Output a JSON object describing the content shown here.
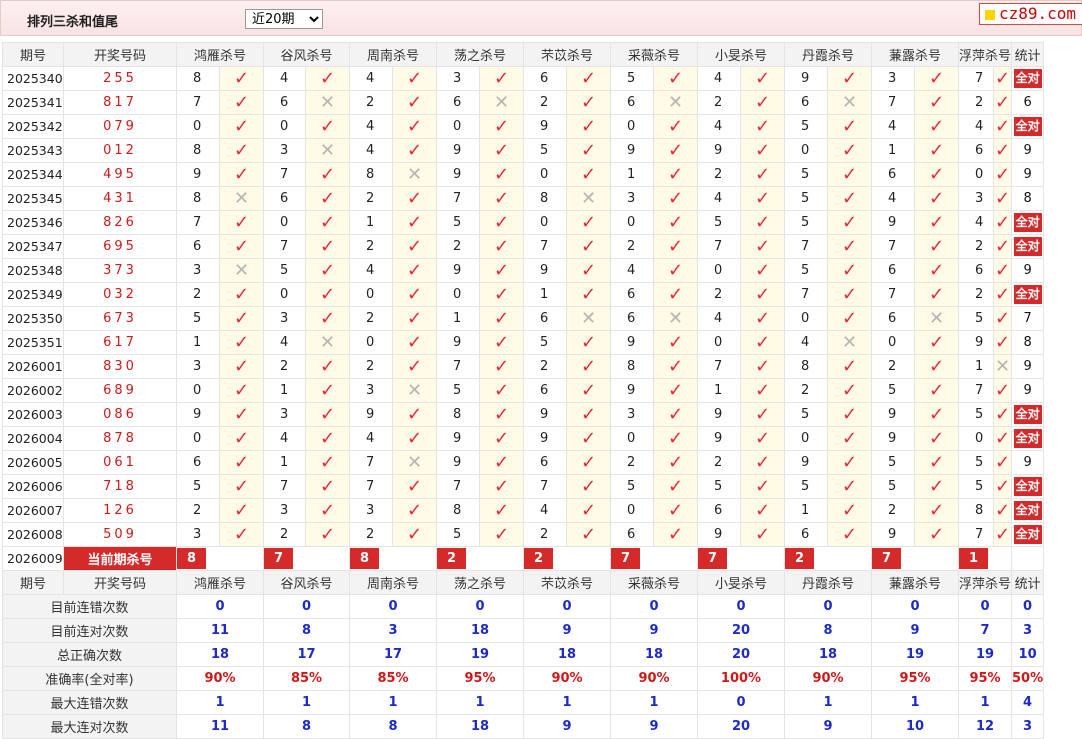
{
  "toolbar": {
    "title": "排列三杀和值尾",
    "period_options": [
      "近20期"
    ],
    "period_selected": "近20期",
    "logo_text": "cz89.com"
  },
  "columns": {
    "issue_label": "期号",
    "number_label": "开奖号码",
    "killers": [
      "鸿雁杀号",
      "谷风杀号",
      "周南杀号",
      "荡之杀号",
      "芣苡杀号",
      "采薇杀号",
      "小旻杀号",
      "丹霞杀号",
      "蒹露杀号",
      "浮萍杀号"
    ],
    "stat_label": "统计"
  },
  "rows": [
    {
      "issue": "2025340",
      "number": "255",
      "kills": [
        {
          "v": "8",
          "ok": true
        },
        {
          "v": "4",
          "ok": true
        },
        {
          "v": "4",
          "ok": true
        },
        {
          "v": "3",
          "ok": true
        },
        {
          "v": "6",
          "ok": true
        },
        {
          "v": "5",
          "ok": true
        },
        {
          "v": "4",
          "ok": true
        },
        {
          "v": "9",
          "ok": true
        },
        {
          "v": "3",
          "ok": true
        },
        {
          "v": "7",
          "ok": true
        }
      ],
      "stat": "全对"
    },
    {
      "issue": "2025341",
      "number": "817",
      "kills": [
        {
          "v": "7",
          "ok": true
        },
        {
          "v": "6",
          "ok": false
        },
        {
          "v": "2",
          "ok": true
        },
        {
          "v": "6",
          "ok": false
        },
        {
          "v": "2",
          "ok": true
        },
        {
          "v": "6",
          "ok": false
        },
        {
          "v": "2",
          "ok": true
        },
        {
          "v": "6",
          "ok": false
        },
        {
          "v": "7",
          "ok": true
        },
        {
          "v": "2",
          "ok": true
        }
      ],
      "stat": "6"
    },
    {
      "issue": "2025342",
      "number": "079",
      "kills": [
        {
          "v": "0",
          "ok": true
        },
        {
          "v": "0",
          "ok": true
        },
        {
          "v": "4",
          "ok": true
        },
        {
          "v": "0",
          "ok": true
        },
        {
          "v": "9",
          "ok": true
        },
        {
          "v": "0",
          "ok": true
        },
        {
          "v": "4",
          "ok": true
        },
        {
          "v": "5",
          "ok": true
        },
        {
          "v": "4",
          "ok": true
        },
        {
          "v": "4",
          "ok": true
        }
      ],
      "stat": "全对"
    },
    {
      "issue": "2025343",
      "number": "012",
      "kills": [
        {
          "v": "8",
          "ok": true
        },
        {
          "v": "3",
          "ok": false
        },
        {
          "v": "4",
          "ok": true
        },
        {
          "v": "9",
          "ok": true
        },
        {
          "v": "5",
          "ok": true
        },
        {
          "v": "9",
          "ok": true
        },
        {
          "v": "9",
          "ok": true
        },
        {
          "v": "0",
          "ok": true
        },
        {
          "v": "1",
          "ok": true
        },
        {
          "v": "6",
          "ok": true
        }
      ],
      "stat": "9"
    },
    {
      "issue": "2025344",
      "number": "495",
      "kills": [
        {
          "v": "9",
          "ok": true
        },
        {
          "v": "7",
          "ok": true
        },
        {
          "v": "8",
          "ok": false
        },
        {
          "v": "9",
          "ok": true
        },
        {
          "v": "0",
          "ok": true
        },
        {
          "v": "1",
          "ok": true
        },
        {
          "v": "2",
          "ok": true
        },
        {
          "v": "5",
          "ok": true
        },
        {
          "v": "6",
          "ok": true
        },
        {
          "v": "0",
          "ok": true
        }
      ],
      "stat": "9"
    },
    {
      "issue": "2025345",
      "number": "431",
      "kills": [
        {
          "v": "8",
          "ok": false
        },
        {
          "v": "6",
          "ok": true
        },
        {
          "v": "2",
          "ok": true
        },
        {
          "v": "7",
          "ok": true
        },
        {
          "v": "8",
          "ok": false
        },
        {
          "v": "3",
          "ok": true
        },
        {
          "v": "4",
          "ok": true
        },
        {
          "v": "5",
          "ok": true
        },
        {
          "v": "4",
          "ok": true
        },
        {
          "v": "3",
          "ok": true
        }
      ],
      "stat": "8"
    },
    {
      "issue": "2025346",
      "number": "826",
      "kills": [
        {
          "v": "7",
          "ok": true
        },
        {
          "v": "0",
          "ok": true
        },
        {
          "v": "1",
          "ok": true
        },
        {
          "v": "5",
          "ok": true
        },
        {
          "v": "0",
          "ok": true
        },
        {
          "v": "0",
          "ok": true
        },
        {
          "v": "5",
          "ok": true
        },
        {
          "v": "5",
          "ok": true
        },
        {
          "v": "9",
          "ok": true
        },
        {
          "v": "4",
          "ok": true
        }
      ],
      "stat": "全对"
    },
    {
      "issue": "2025347",
      "number": "695",
      "kills": [
        {
          "v": "6",
          "ok": true
        },
        {
          "v": "7",
          "ok": true
        },
        {
          "v": "2",
          "ok": true
        },
        {
          "v": "2",
          "ok": true
        },
        {
          "v": "7",
          "ok": true
        },
        {
          "v": "2",
          "ok": true
        },
        {
          "v": "7",
          "ok": true
        },
        {
          "v": "7",
          "ok": true
        },
        {
          "v": "7",
          "ok": true
        },
        {
          "v": "2",
          "ok": true
        }
      ],
      "stat": "全对"
    },
    {
      "issue": "2025348",
      "number": "373",
      "kills": [
        {
          "v": "3",
          "ok": false
        },
        {
          "v": "5",
          "ok": true
        },
        {
          "v": "4",
          "ok": true
        },
        {
          "v": "9",
          "ok": true
        },
        {
          "v": "9",
          "ok": true
        },
        {
          "v": "4",
          "ok": true
        },
        {
          "v": "0",
          "ok": true
        },
        {
          "v": "5",
          "ok": true
        },
        {
          "v": "6",
          "ok": true
        },
        {
          "v": "6",
          "ok": true
        }
      ],
      "stat": "9"
    },
    {
      "issue": "2025349",
      "number": "032",
      "kills": [
        {
          "v": "2",
          "ok": true
        },
        {
          "v": "0",
          "ok": true
        },
        {
          "v": "0",
          "ok": true
        },
        {
          "v": "0",
          "ok": true
        },
        {
          "v": "1",
          "ok": true
        },
        {
          "v": "6",
          "ok": true
        },
        {
          "v": "2",
          "ok": true
        },
        {
          "v": "7",
          "ok": true
        },
        {
          "v": "7",
          "ok": true
        },
        {
          "v": "2",
          "ok": true
        }
      ],
      "stat": "全对"
    },
    {
      "issue": "2025350",
      "number": "673",
      "kills": [
        {
          "v": "5",
          "ok": true
        },
        {
          "v": "3",
          "ok": true
        },
        {
          "v": "2",
          "ok": true
        },
        {
          "v": "1",
          "ok": true
        },
        {
          "v": "6",
          "ok": false
        },
        {
          "v": "6",
          "ok": false
        },
        {
          "v": "4",
          "ok": true
        },
        {
          "v": "0",
          "ok": true
        },
        {
          "v": "6",
          "ok": false
        },
        {
          "v": "5",
          "ok": true
        }
      ],
      "stat": "7"
    },
    {
      "issue": "2025351",
      "number": "617",
      "kills": [
        {
          "v": "1",
          "ok": true
        },
        {
          "v": "4",
          "ok": false
        },
        {
          "v": "0",
          "ok": true
        },
        {
          "v": "9",
          "ok": true
        },
        {
          "v": "5",
          "ok": true
        },
        {
          "v": "9",
          "ok": true
        },
        {
          "v": "0",
          "ok": true
        },
        {
          "v": "4",
          "ok": false
        },
        {
          "v": "0",
          "ok": true
        },
        {
          "v": "9",
          "ok": true
        }
      ],
      "stat": "8"
    },
    {
      "issue": "2026001",
      "number": "830",
      "kills": [
        {
          "v": "3",
          "ok": true
        },
        {
          "v": "2",
          "ok": true
        },
        {
          "v": "2",
          "ok": true
        },
        {
          "v": "7",
          "ok": true
        },
        {
          "v": "2",
          "ok": true
        },
        {
          "v": "8",
          "ok": true
        },
        {
          "v": "7",
          "ok": true
        },
        {
          "v": "8",
          "ok": true
        },
        {
          "v": "2",
          "ok": true
        },
        {
          "v": "1",
          "ok": false
        }
      ],
      "stat": "9"
    },
    {
      "issue": "2026002",
      "number": "689",
      "kills": [
        {
          "v": "0",
          "ok": true
        },
        {
          "v": "1",
          "ok": true
        },
        {
          "v": "3",
          "ok": false
        },
        {
          "v": "5",
          "ok": true
        },
        {
          "v": "6",
          "ok": true
        },
        {
          "v": "9",
          "ok": true
        },
        {
          "v": "1",
          "ok": true
        },
        {
          "v": "2",
          "ok": true
        },
        {
          "v": "5",
          "ok": true
        },
        {
          "v": "7",
          "ok": true
        }
      ],
      "stat": "9"
    },
    {
      "issue": "2026003",
      "number": "086",
      "kills": [
        {
          "v": "9",
          "ok": true
        },
        {
          "v": "3",
          "ok": true
        },
        {
          "v": "9",
          "ok": true
        },
        {
          "v": "8",
          "ok": true
        },
        {
          "v": "9",
          "ok": true
        },
        {
          "v": "3",
          "ok": true
        },
        {
          "v": "9",
          "ok": true
        },
        {
          "v": "5",
          "ok": true
        },
        {
          "v": "9",
          "ok": true
        },
        {
          "v": "5",
          "ok": true
        }
      ],
      "stat": "全对"
    },
    {
      "issue": "2026004",
      "number": "878",
      "kills": [
        {
          "v": "0",
          "ok": true
        },
        {
          "v": "4",
          "ok": true
        },
        {
          "v": "4",
          "ok": true
        },
        {
          "v": "9",
          "ok": true
        },
        {
          "v": "9",
          "ok": true
        },
        {
          "v": "0",
          "ok": true
        },
        {
          "v": "9",
          "ok": true
        },
        {
          "v": "0",
          "ok": true
        },
        {
          "v": "9",
          "ok": true
        },
        {
          "v": "0",
          "ok": true
        }
      ],
      "stat": "全对"
    },
    {
      "issue": "2026005",
      "number": "061",
      "kills": [
        {
          "v": "6",
          "ok": true
        },
        {
          "v": "1",
          "ok": true
        },
        {
          "v": "7",
          "ok": false
        },
        {
          "v": "9",
          "ok": true
        },
        {
          "v": "6",
          "ok": true
        },
        {
          "v": "2",
          "ok": true
        },
        {
          "v": "2",
          "ok": true
        },
        {
          "v": "9",
          "ok": true
        },
        {
          "v": "5",
          "ok": true
        },
        {
          "v": "5",
          "ok": true
        }
      ],
      "stat": "9"
    },
    {
      "issue": "2026006",
      "number": "718",
      "kills": [
        {
          "v": "5",
          "ok": true
        },
        {
          "v": "7",
          "ok": true
        },
        {
          "v": "7",
          "ok": true
        },
        {
          "v": "7",
          "ok": true
        },
        {
          "v": "7",
          "ok": true
        },
        {
          "v": "5",
          "ok": true
        },
        {
          "v": "5",
          "ok": true
        },
        {
          "v": "5",
          "ok": true
        },
        {
          "v": "5",
          "ok": true
        },
        {
          "v": "5",
          "ok": true
        }
      ],
      "stat": "全对"
    },
    {
      "issue": "2026007",
      "number": "126",
      "kills": [
        {
          "v": "2",
          "ok": true
        },
        {
          "v": "3",
          "ok": true
        },
        {
          "v": "3",
          "ok": true
        },
        {
          "v": "8",
          "ok": true
        },
        {
          "v": "4",
          "ok": true
        },
        {
          "v": "0",
          "ok": true
        },
        {
          "v": "6",
          "ok": true
        },
        {
          "v": "1",
          "ok": true
        },
        {
          "v": "2",
          "ok": true
        },
        {
          "v": "8",
          "ok": true
        }
      ],
      "stat": "全对"
    },
    {
      "issue": "2026008",
      "number": "509",
      "kills": [
        {
          "v": "3",
          "ok": true
        },
        {
          "v": "2",
          "ok": true
        },
        {
          "v": "2",
          "ok": true
        },
        {
          "v": "5",
          "ok": true
        },
        {
          "v": "2",
          "ok": true
        },
        {
          "v": "6",
          "ok": true
        },
        {
          "v": "9",
          "ok": true
        },
        {
          "v": "6",
          "ok": true
        },
        {
          "v": "9",
          "ok": true
        },
        {
          "v": "7",
          "ok": true
        }
      ],
      "stat": "全对"
    }
  ],
  "current": {
    "issue": "2026009",
    "label": "当前期杀号",
    "kills": [
      "8",
      "7",
      "8",
      "2",
      "2",
      "7",
      "7",
      "2",
      "7",
      "1"
    ]
  },
  "summary": [
    {
      "label": "目前连错次数",
      "values": [
        "0",
        "0",
        "0",
        "0",
        "0",
        "0",
        "0",
        "0",
        "0",
        "0"
      ],
      "stat": "0",
      "type": "v"
    },
    {
      "label": "目前连对次数",
      "values": [
        "11",
        "8",
        "3",
        "18",
        "9",
        "9",
        "20",
        "8",
        "9",
        "7"
      ],
      "stat": "3",
      "type": "v"
    },
    {
      "label": "总正确次数",
      "values": [
        "18",
        "17",
        "17",
        "19",
        "18",
        "18",
        "20",
        "18",
        "19",
        "19"
      ],
      "stat": "10",
      "type": "v"
    },
    {
      "label": "准确率(全对率)",
      "values": [
        "90%",
        "85%",
        "85%",
        "95%",
        "90%",
        "90%",
        "100%",
        "90%",
        "95%",
        "95%"
      ],
      "stat": "50%",
      "type": "r"
    },
    {
      "label": "最大连错次数",
      "values": [
        "1",
        "1",
        "1",
        "1",
        "1",
        "1",
        "0",
        "1",
        "1",
        "1"
      ],
      "stat": "4",
      "type": "v"
    },
    {
      "label": "最大连对次数",
      "values": [
        "11",
        "8",
        "8",
        "18",
        "9",
        "9",
        "20",
        "9",
        "10",
        "12"
      ],
      "stat": "3",
      "type": "v"
    }
  ],
  "colors": {
    "accent": "#d42a2a",
    "tick": "#e8283a",
    "cross": "#b5b5b5",
    "value_blue": "#1d2ac8",
    "mark_bg": "#fffbe6"
  },
  "icons": {
    "ok": "check-icon",
    "wrong": "cross-icon"
  }
}
